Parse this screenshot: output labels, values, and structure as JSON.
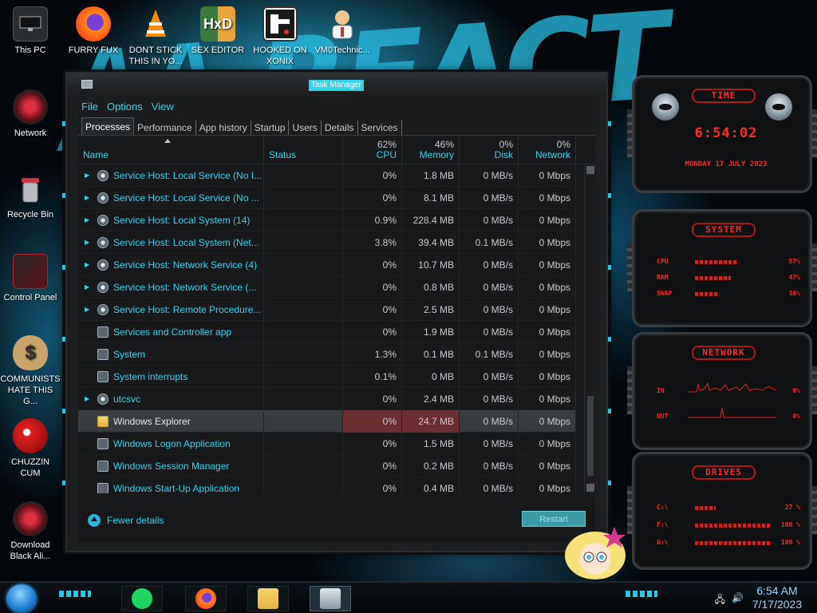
{
  "desktop": {
    "icons": [
      {
        "label": "This PC",
        "icon": "monitor-icon"
      },
      {
        "label": "FURRY FUX",
        "icon": "firefox-icon"
      },
      {
        "label": "DONT STICK THIS IN YO...",
        "icon": "vlc-cone-icon"
      },
      {
        "label": "SEX EDITOR",
        "icon": "hxd-icon"
      },
      {
        "label": "HOOKED ON XONIX",
        "icon": "xonix-icon"
      },
      {
        "label": "VM0Technic...",
        "icon": "doctor-icon"
      },
      {
        "label": "Network",
        "icon": "alienware-icon"
      },
      {
        "label": "Recycle Bin",
        "icon": "trash-icon"
      },
      {
        "label": "Control Panel",
        "icon": "control-panel-icon"
      },
      {
        "label": "COMMUNISTS HATE THIS G...",
        "icon": "money-bag-icon"
      },
      {
        "label": "CHUZZIN CUM",
        "icon": "chuzzle-icon"
      },
      {
        "label": "Download Black Ali...",
        "icon": "alienware-icon"
      }
    ]
  },
  "task_manager": {
    "title": "Task Manager",
    "menu": [
      "File",
      "Options",
      "View"
    ],
    "tabs": [
      "Processes",
      "Performance",
      "App history",
      "Startup",
      "Users",
      "Details",
      "Services"
    ],
    "active_tab": "Processes",
    "columns": {
      "name": "Name",
      "status": "Status",
      "cpu": {
        "label": "CPU",
        "pct": "62%"
      },
      "memory": {
        "label": "Memory",
        "pct": "46%"
      },
      "disk": {
        "label": "Disk",
        "pct": "0%"
      },
      "network": {
        "label": "Network",
        "pct": "0%"
      }
    },
    "rows": [
      {
        "name": "Service Host: Local Service (No I...",
        "cpu": "0%",
        "memory": "1.8 MB",
        "disk": "0 MB/s",
        "network": "0 Mbps",
        "expand": true,
        "icon": "gear"
      },
      {
        "name": "Service Host: Local Service (No ...",
        "cpu": "0%",
        "memory": "8.1 MB",
        "disk": "0 MB/s",
        "network": "0 Mbps",
        "expand": true,
        "icon": "gear"
      },
      {
        "name": "Service Host: Local System (14)",
        "cpu": "0.9%",
        "memory": "228.4 MB",
        "disk": "0 MB/s",
        "network": "0 Mbps",
        "expand": true,
        "icon": "gear"
      },
      {
        "name": "Service Host: Local System (Net...",
        "cpu": "3.8%",
        "memory": "39.4 MB",
        "disk": "0.1 MB/s",
        "network": "0 Mbps",
        "expand": true,
        "icon": "gear"
      },
      {
        "name": "Service Host: Network Service (4)",
        "cpu": "0%",
        "memory": "10.7 MB",
        "disk": "0 MB/s",
        "network": "0 Mbps",
        "expand": true,
        "icon": "gear"
      },
      {
        "name": "Service Host: Network Service (...",
        "cpu": "0%",
        "memory": "0.8 MB",
        "disk": "0 MB/s",
        "network": "0 Mbps",
        "expand": true,
        "icon": "gear"
      },
      {
        "name": "Service Host: Remote Procedure...",
        "cpu": "0%",
        "memory": "2.5 MB",
        "disk": "0 MB/s",
        "network": "0 Mbps",
        "expand": true,
        "icon": "gear"
      },
      {
        "name": "Services and Controller app",
        "cpu": "0%",
        "memory": "1.9 MB",
        "disk": "0 MB/s",
        "network": "0 Mbps",
        "expand": false,
        "icon": "app"
      },
      {
        "name": "System",
        "cpu": "1.3%",
        "memory": "0.1 MB",
        "disk": "0.1 MB/s",
        "network": "0 Mbps",
        "expand": false,
        "icon": "app"
      },
      {
        "name": "System interrupts",
        "cpu": "0.1%",
        "memory": "0 MB",
        "disk": "0 MB/s",
        "network": "0 Mbps",
        "expand": false,
        "icon": "app"
      },
      {
        "name": "utcsvc",
        "cpu": "0%",
        "memory": "2.4 MB",
        "disk": "0 MB/s",
        "network": "0 Mbps",
        "expand": true,
        "icon": "gear"
      },
      {
        "name": "Windows Explorer",
        "cpu": "0%",
        "memory": "24.7 MB",
        "disk": "0 MB/s",
        "network": "0 Mbps",
        "expand": false,
        "icon": "folder",
        "selected": true
      },
      {
        "name": "Windows Logon Application",
        "cpu": "0%",
        "memory": "1.5 MB",
        "disk": "0 MB/s",
        "network": "0 Mbps",
        "expand": false,
        "icon": "app"
      },
      {
        "name": "Windows Session Manager",
        "cpu": "0%",
        "memory": "0.2 MB",
        "disk": "0 MB/s",
        "network": "0 Mbps",
        "expand": false,
        "icon": "app"
      },
      {
        "name": "Windows Start-Up Application",
        "cpu": "0%",
        "memory": "0.4 MB",
        "disk": "0 MB/s",
        "network": "0 Mbps",
        "expand": false,
        "icon": "app"
      }
    ],
    "fewer_details": "Fewer details",
    "restart_button": "Restart"
  },
  "widgets": {
    "time": {
      "title": "TIME",
      "clock": "6:54:02",
      "date": "MONDAY 17 JULY 2023"
    },
    "system": {
      "title": "SYSTEM",
      "rows": [
        {
          "label": "CPU",
          "value": "57%",
          "fraction": 0.57
        },
        {
          "label": "RAM",
          "value": "47%",
          "fraction": 0.47
        },
        {
          "label": "SWAP",
          "value": "30%",
          "fraction": 0.3
        }
      ]
    },
    "network": {
      "title": "NETWORK",
      "rows": [
        {
          "label": "IN",
          "value": "0%"
        },
        {
          "label": "OUT",
          "value": "0%"
        }
      ]
    },
    "drives": {
      "title": "DRIVES",
      "rows": [
        {
          "label": "C:\\",
          "value": "27 %",
          "fraction": 0.27
        },
        {
          "label": "F:\\",
          "value": "100 %",
          "fraction": 1.0
        },
        {
          "label": "G:\\",
          "value": "100 %",
          "fraction": 1.0
        }
      ]
    }
  },
  "taskbar": {
    "apps": [
      "spotify-icon",
      "firefox-icon",
      "file-explorer-icon",
      "task-manager-icon"
    ],
    "time": "6:54 AM",
    "date": "7/17/2023"
  },
  "colors": {
    "accent": "#34d5ef",
    "widget_red": "#ff2a2a",
    "selected_highlight": "#6a2f33"
  }
}
